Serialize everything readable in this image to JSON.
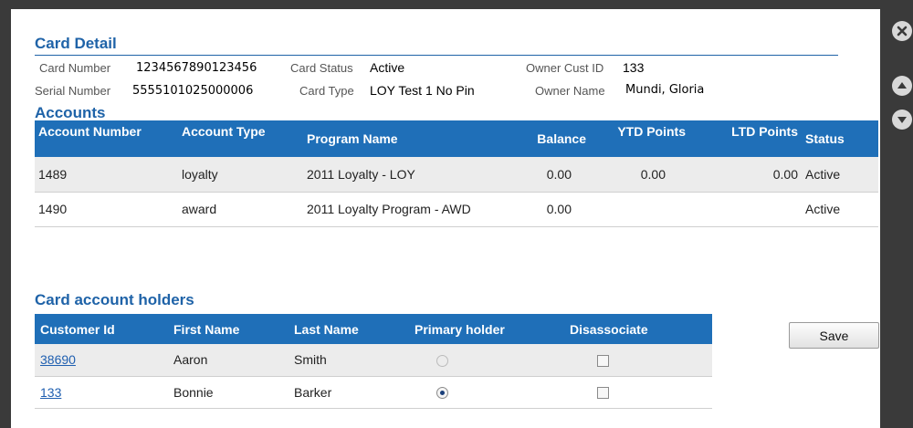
{
  "card_detail": {
    "title": "Card Detail",
    "card_number_label": "Card Number",
    "card_number": "1234567890123456",
    "serial_number_label": "Serial Number",
    "serial_number": "5555101025000006",
    "card_status_label": "Card Status",
    "card_status": "Active",
    "card_type_label": "Card Type",
    "card_type": "LOY Test 1 No Pin",
    "owner_cust_id_label": "Owner Cust ID",
    "owner_cust_id": "133",
    "owner_name_label": "Owner Name",
    "owner_name": "Mundi, Gloria"
  },
  "accounts": {
    "title": "Accounts",
    "headers": [
      "Account Number",
      "Account Type",
      "Program Name",
      "Balance",
      "YTD Points",
      "LTD Points",
      "Status"
    ],
    "rows": [
      {
        "account_number": "1489",
        "account_type": "loyalty",
        "program_name": "2011 Loyalty - LOY",
        "balance": "0.00",
        "ytd_points": "0.00",
        "ltd_points": "0.00",
        "status": "Active"
      },
      {
        "account_number": "1490",
        "account_type": "award",
        "program_name": "2011 Loyalty Program - AWD",
        "balance": "0.00",
        "ytd_points": "",
        "ltd_points": "",
        "status": "Active"
      }
    ]
  },
  "holders": {
    "title": "Card account holders",
    "headers": [
      "Customer Id",
      "First Name",
      "Last Name",
      "Primary holder",
      "Disassociate"
    ],
    "rows": [
      {
        "customer_id": "38690",
        "first_name": "Aaron",
        "last_name": "Smith",
        "primary_holder": false,
        "disassociate": false
      },
      {
        "customer_id": "133",
        "first_name": "Bonnie",
        "last_name": "Barker",
        "primary_holder": true,
        "disassociate": false
      }
    ]
  },
  "buttons": {
    "save_label": "Save"
  },
  "icons": {
    "close": "close-icon",
    "up": "arrow-up-icon",
    "down": "arrow-down-icon"
  },
  "colors": {
    "accent": "#1f6fb8",
    "title": "#1f63a8"
  }
}
